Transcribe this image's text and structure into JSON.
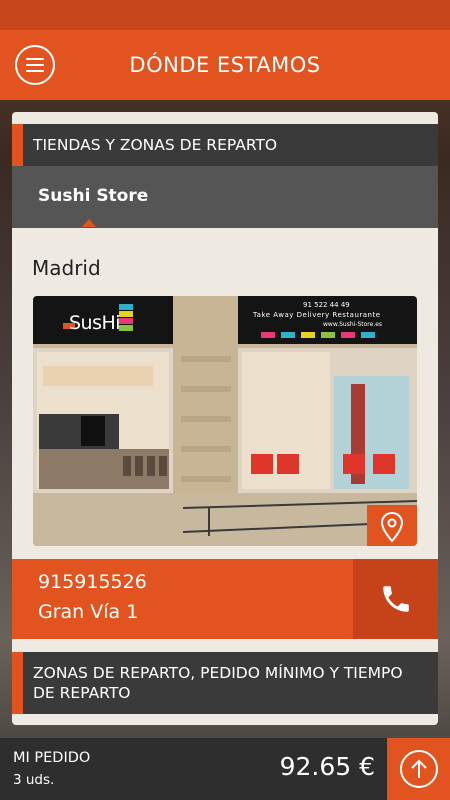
{
  "header": {
    "title": "DÓNDE ESTAMOS",
    "menu_icon": "hamburger-menu-icon"
  },
  "stores_section": {
    "title": "TIENDAS Y ZONAS DE REPARTO"
  },
  "store_tab": {
    "label": "Sushi Store"
  },
  "store": {
    "city": "Madrid",
    "phone": "915915526",
    "address": "Gran Vía 1",
    "sign": {
      "logo": "SusHi",
      "phone": "91 522 44 49",
      "services": "Take Away   Delivery   Restaurante",
      "web": "www.Sushi-Store.es"
    }
  },
  "actions": {
    "location_icon": "map-pin-icon",
    "mail_icon": "envelope-icon",
    "call_icon": "phone-icon"
  },
  "delivery_section": {
    "title": "ZONAS DE REPARTO, PEDIDO MÍNIMO Y TIEMPO DE REPARTO"
  },
  "footer": {
    "label": "MI PEDIDO",
    "units": "3 uds.",
    "total": "92.65 €",
    "up_icon": "arrow-up-icon"
  },
  "colors": {
    "accent": "#e2541f",
    "dark": "#3a3a3a",
    "card": "#eee9e1"
  }
}
